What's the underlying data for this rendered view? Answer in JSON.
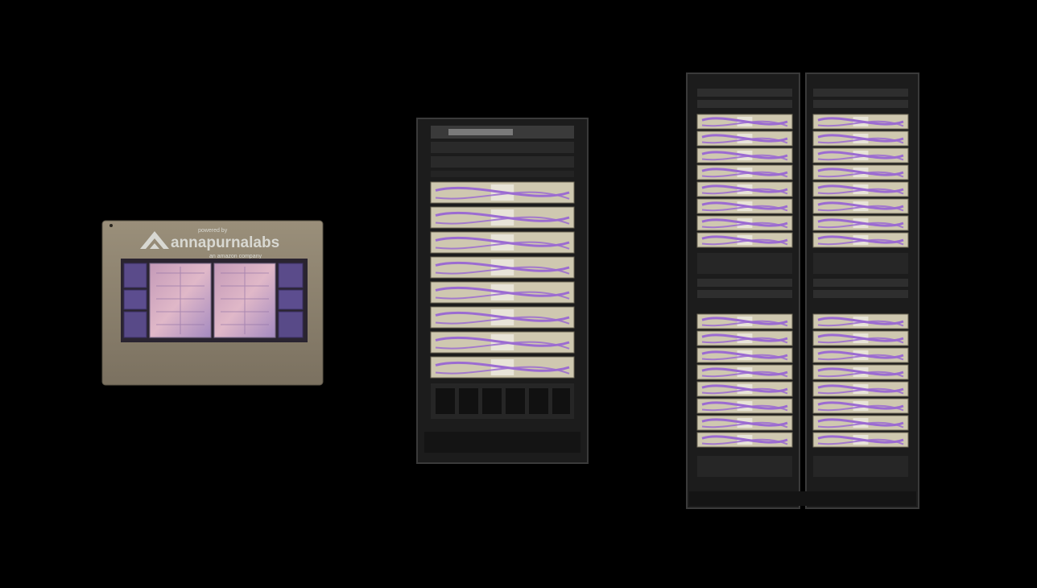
{
  "scene": {
    "background_color": "#000000",
    "objects": [
      {
        "name": "trainium-chip",
        "kind": "chip package"
      },
      {
        "name": "server-rack",
        "kind": "single rack"
      },
      {
        "name": "ultraserver-rack-pair",
        "kind": "double rack"
      }
    ]
  },
  "chip": {
    "powered_by": "powered by",
    "brand": "annapurnalabs",
    "tagline": "an amazon company",
    "colors": {
      "lid": "#8d826d",
      "die": "#c89ac0",
      "hbm": "#5a4b8a"
    }
  },
  "rack": {
    "colors": {
      "frame": "#1c1c1c",
      "cable": "#9b6bd1",
      "tray": "#cfc8b0"
    }
  }
}
